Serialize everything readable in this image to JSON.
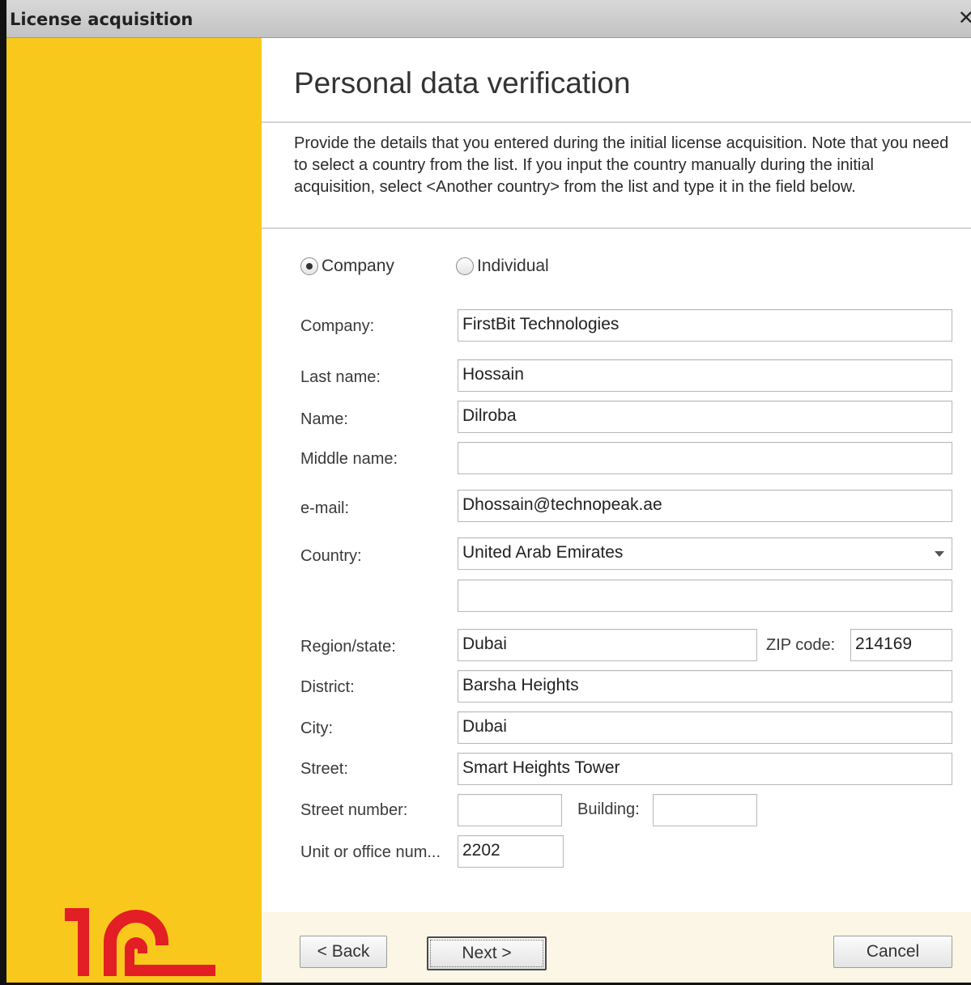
{
  "window": {
    "title": "License acquisition",
    "close_glyph": "✕"
  },
  "page": {
    "title": "Personal data verification",
    "description": "Provide the details that you entered during the initial license acquisition. Note that you need to select a country from the list. If you input the country manually during the initial acquisition, select <Another country> from the list and type it in the field below."
  },
  "customer_type": {
    "selected": "Company",
    "options": [
      {
        "label": "Company"
      },
      {
        "label": "Individual"
      }
    ]
  },
  "form": {
    "company": {
      "label": "Company:",
      "value": "FirstBit Technologies"
    },
    "last_name": {
      "label": "Last name:",
      "value": "Hossain"
    },
    "name": {
      "label": "Name:",
      "value": "Dilroba"
    },
    "middle_name": {
      "label": "Middle name:",
      "value": ""
    },
    "email": {
      "label": "e-mail:",
      "value": "Dhossain@technopeak.ae"
    },
    "country": {
      "label": "Country:",
      "value": "United Arab Emirates"
    },
    "other_country": {
      "value": ""
    },
    "region": {
      "label": "Region/state:",
      "value": "Dubai"
    },
    "zip": {
      "label": "ZIP code:",
      "value": "214169"
    },
    "district": {
      "label": "District:",
      "value": "Barsha Heights"
    },
    "city": {
      "label": "City:",
      "value": "Dubai"
    },
    "street": {
      "label": "Street:",
      "value": "Smart Heights Tower"
    },
    "street_number": {
      "label": "Street number:",
      "value": ""
    },
    "building": {
      "label": "Building:",
      "value": ""
    },
    "unit": {
      "label": "Unit or office num...",
      "value": "2202"
    }
  },
  "buttons": {
    "back": "< Back",
    "next": "Next >",
    "cancel": "Cancel"
  },
  "colors": {
    "sidebar": "#f9c81d",
    "logo": "#e31e24",
    "footer": "#fbf6e5"
  },
  "icons": {
    "logo": "1c-logo",
    "close": "close-icon",
    "dropdown": "chevron-down-icon"
  }
}
